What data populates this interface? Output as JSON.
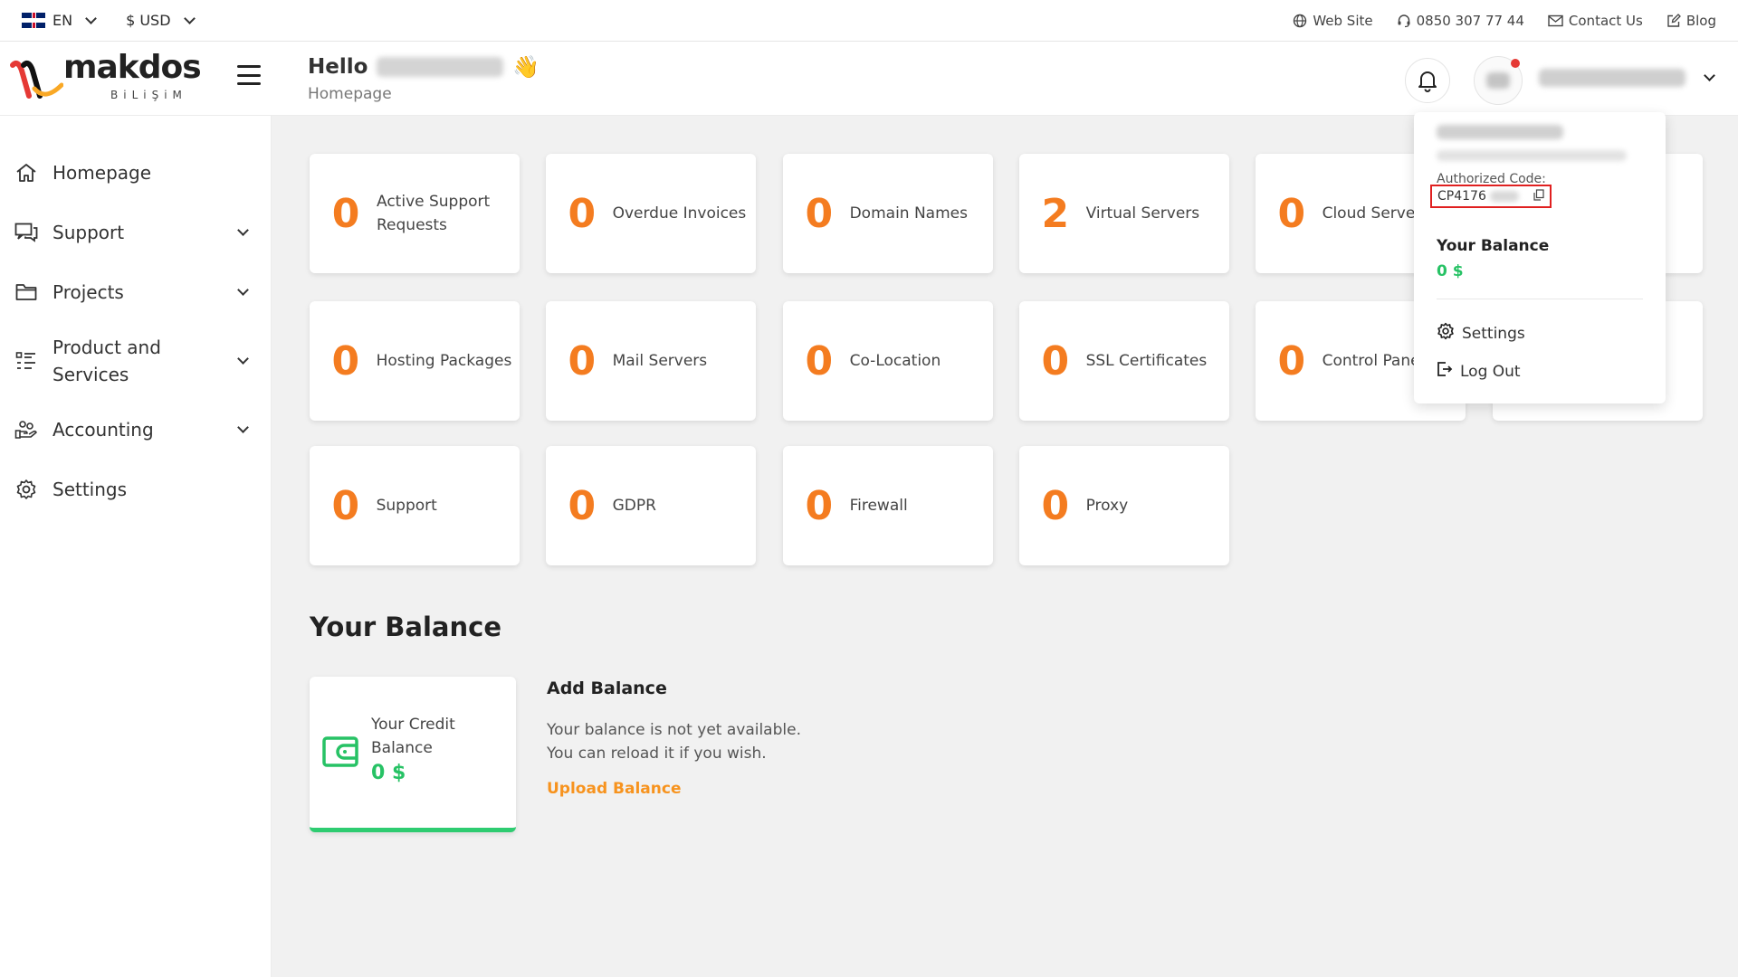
{
  "topbar": {
    "language": "EN",
    "currency": "$ USD",
    "links": [
      {
        "label": "Web Site"
      },
      {
        "label": "0850 307 77 44"
      },
      {
        "label": "Contact Us"
      },
      {
        "label": "Blog"
      }
    ]
  },
  "logo": {
    "word": "makdos",
    "sub": "BiLiŞiM"
  },
  "header": {
    "greeting": "Hello",
    "breadcrumb": "Homepage"
  },
  "sidebar": {
    "items": [
      {
        "label": "Homepage"
      },
      {
        "label": "Support"
      },
      {
        "label": "Projects"
      },
      {
        "label": "Product and Services"
      },
      {
        "label": "Accounting"
      },
      {
        "label": "Settings"
      }
    ]
  },
  "stats": [
    {
      "value": "0",
      "label": "Active Support Requests"
    },
    {
      "value": "0",
      "label": "Overdue Invoices"
    },
    {
      "value": "0",
      "label": "Domain Names"
    },
    {
      "value": "2",
      "label": "Virtual Servers"
    },
    {
      "value": "0",
      "label": "Cloud Servers"
    },
    {
      "value": "0",
      "label": "Hosting Packages"
    },
    {
      "value": "0",
      "label": "Mail Servers"
    },
    {
      "value": "0",
      "label": "Co-Location"
    },
    {
      "value": "0",
      "label": "SSL Certificates"
    },
    {
      "value": "0",
      "label": "Control Panels"
    },
    {
      "value": "0",
      "label": "Support"
    },
    {
      "value": "0",
      "label": "GDPR"
    },
    {
      "value": "0",
      "label": "Firewall"
    },
    {
      "value": "0",
      "label": "Proxy"
    }
  ],
  "balance": {
    "title": "Your Balance",
    "credit_label": "Your Credit Balance",
    "credit_value": "0 $",
    "add_title": "Add Balance",
    "add_desc_1": "Your balance is not yet available.",
    "add_desc_2": "You can reload it if you wish.",
    "add_link": "Upload Balance"
  },
  "dropdown": {
    "auth_label": "Authorized Code:",
    "auth_code": "CP4176",
    "balance_label": "Your Balance",
    "balance_value": "0 $",
    "settings": "Settings",
    "logout": "Log Out"
  },
  "colors": {
    "accent_orange": "#f47c20",
    "balance_green": "#27c265",
    "link_orange": "#f7931e",
    "highlight_red": "#e02020"
  }
}
